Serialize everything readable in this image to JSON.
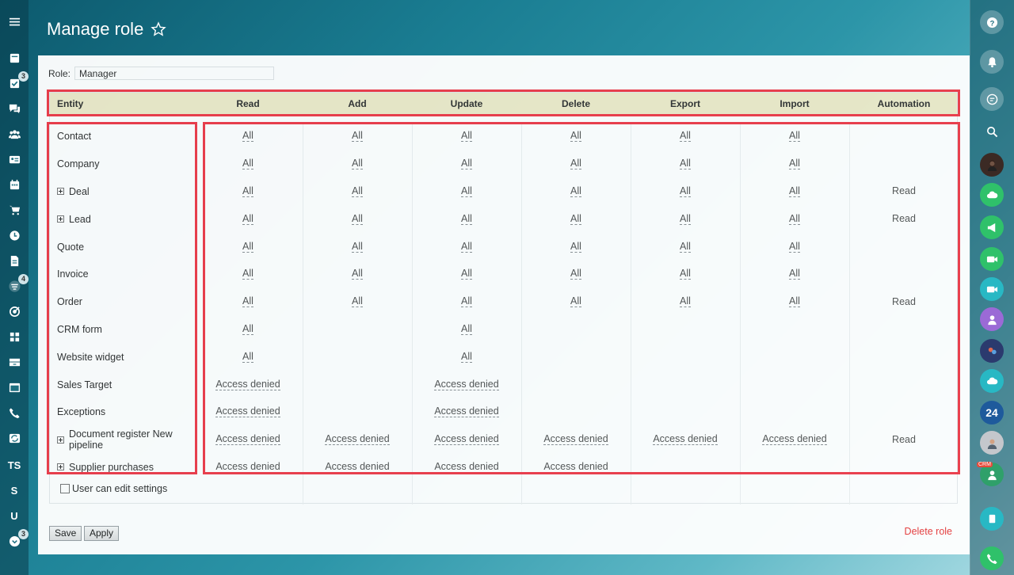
{
  "page": {
    "title": "Manage role"
  },
  "role": {
    "label": "Role:",
    "value": "Manager"
  },
  "columns": [
    "Entity",
    "Read",
    "Add",
    "Update",
    "Delete",
    "Export",
    "Import",
    "Automation"
  ],
  "rows": [
    {
      "entity": "Contact",
      "expandable": false,
      "perms": [
        "All",
        "All",
        "All",
        "All",
        "All",
        "All",
        ""
      ]
    },
    {
      "entity": "Company",
      "expandable": false,
      "perms": [
        "All",
        "All",
        "All",
        "All",
        "All",
        "All",
        ""
      ]
    },
    {
      "entity": "Deal",
      "expandable": true,
      "perms": [
        "All",
        "All",
        "All",
        "All",
        "All",
        "All",
        "Read"
      ]
    },
    {
      "entity": "Lead",
      "expandable": true,
      "perms": [
        "All",
        "All",
        "All",
        "All",
        "All",
        "All",
        "Read"
      ]
    },
    {
      "entity": "Quote",
      "expandable": false,
      "perms": [
        "All",
        "All",
        "All",
        "All",
        "All",
        "All",
        ""
      ]
    },
    {
      "entity": "Invoice",
      "expandable": false,
      "perms": [
        "All",
        "All",
        "All",
        "All",
        "All",
        "All",
        ""
      ]
    },
    {
      "entity": "Order",
      "expandable": false,
      "perms": [
        "All",
        "All",
        "All",
        "All",
        "All",
        "All",
        "Read"
      ]
    },
    {
      "entity": "CRM form",
      "expandable": false,
      "perms": [
        "All",
        "",
        "All",
        "",
        "",
        "",
        ""
      ]
    },
    {
      "entity": "Website widget",
      "expandable": false,
      "perms": [
        "All",
        "",
        "All",
        "",
        "",
        "",
        ""
      ]
    },
    {
      "entity": "Sales Target",
      "expandable": false,
      "perms": [
        "Access denied",
        "",
        "Access denied",
        "",
        "",
        "",
        ""
      ]
    },
    {
      "entity": "Exceptions",
      "expandable": false,
      "perms": [
        "Access denied",
        "",
        "Access denied",
        "",
        "",
        "",
        ""
      ]
    },
    {
      "entity": "Document register New pipeline",
      "expandable": true,
      "perms": [
        "Access denied",
        "Access denied",
        "Access denied",
        "Access denied",
        "Access denied",
        "Access denied",
        "Read"
      ]
    },
    {
      "entity": "Supplier purchases",
      "expandable": true,
      "perms": [
        "Access denied",
        "Access denied",
        "Access denied",
        "Access denied",
        "",
        "",
        ""
      ]
    }
  ],
  "settings": {
    "user_can_edit": "User can edit settings"
  },
  "buttons": {
    "save": "Save",
    "apply": "Apply",
    "delete_role": "Delete role"
  },
  "left_nav": [
    {
      "icon": "menu-icon"
    },
    {
      "icon": "feed-icon"
    },
    {
      "icon": "tasks-icon",
      "badge": "3"
    },
    {
      "icon": "chat-icon"
    },
    {
      "icon": "workgroups-icon"
    },
    {
      "icon": "contact-center-icon"
    },
    {
      "icon": "calendar-icon"
    },
    {
      "icon": "shop-icon"
    },
    {
      "icon": "time-icon"
    },
    {
      "icon": "documents-icon"
    },
    {
      "icon": "crm-filter-icon",
      "badge": "4"
    },
    {
      "icon": "targets-icon"
    },
    {
      "icon": "apps-icon"
    },
    {
      "icon": "inventory-icon"
    },
    {
      "icon": "sites-icon"
    },
    {
      "icon": "telephony-icon"
    },
    {
      "icon": "sync-icon"
    },
    {
      "icon": "ts-icon",
      "text": "TS"
    },
    {
      "icon": "s-icon",
      "text": "S"
    },
    {
      "icon": "u-icon",
      "text": "U"
    },
    {
      "icon": "more-icon",
      "badge": "3"
    }
  ],
  "right_nav_badge": {
    "text": "24",
    "crm_label": "CRM"
  },
  "colors": {
    "accent_red": "#ef3c4a",
    "header_bg": "#edeac9",
    "delete_red": "#e83c3c"
  }
}
